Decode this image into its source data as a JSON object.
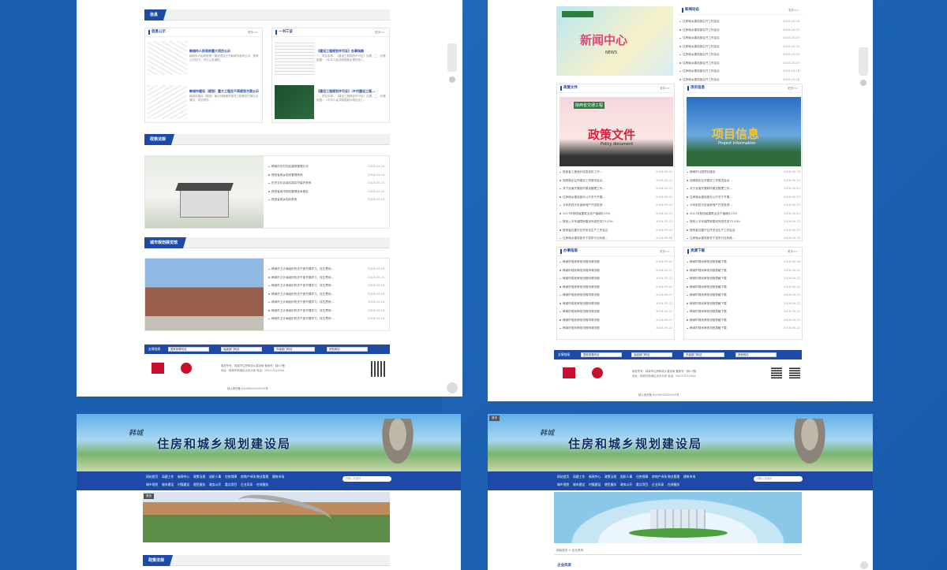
{
  "s1": {
    "info_title": "信息",
    "notice": {
      "title": "信息公示",
      "more": "更多>>",
      "items": [
        {
          "title": "韩城市人民政府重大项目公示",
          "text": "韩城市人民政府第一建设项目已于韩城市各项公示，具体公示如下，详见公告通知。"
        },
        {
          "title": "韩城市建设（规划）重大工程及不同规划方案公示",
          "text": "韩城市建设（规划）局公布韩城市各项工程规划方案公示情况，详见附件。"
        }
      ]
    },
    "one_two_three": {
      "title": "一书三证",
      "more": "更多>>",
      "items": [
        {
          "title": "《建设工程规划许可证》办事指南",
          "text": "一、项目名称：《建设工程规划许可证》办理。二、办理依据：《中华人民共和国城乡规划法》。"
        },
        {
          "title": "《建设工程规划许可证》（乡村建设工程...",
          "text": "一、项目名称：《建设工程规划许可证》办理。二、办理依据：《中华人民共和国城乡规划法》。"
        }
      ]
    },
    "policy": {
      "title": "政策法规",
      "items": [
        {
          "t": "韩城市农村村民建房管理办法",
          "d": "2018-05-14"
        },
        {
          "t": "陕西省城乡规划管理条例",
          "d": "2018-05-14"
        },
        {
          "t": "历史文化名城名镇名村保护条例",
          "d": "2018-05-14"
        },
        {
          "t": "陕西省城市规划管理技术规定",
          "d": "2018-05-10"
        },
        {
          "t": "陕西省城乡规划条例",
          "d": "2018-05-10"
        }
      ]
    },
    "hall": {
      "title": "城市规划展览馆",
      "items": [
        {
          "t": "韩城市卫计局组织机关干部开展学习，传达贯彻...",
          "d": "2018-05-24"
        },
        {
          "t": "韩城市卫计局组织机关干部开展学习，传达贯彻...",
          "d": "2018-05-24"
        },
        {
          "t": "韩城市卫计局组织机关干部开展学习，传达贯彻...",
          "d": "2018-05-24"
        },
        {
          "t": "韩城市卫计局组织机关干部开展学习，传达贯彻...",
          "d": "2018-05-24"
        },
        {
          "t": "韩城市卫计局组织机关干部开展学习，传达贯彻...",
          "d": "2018-05-24"
        },
        {
          "t": "韩城市卫计局组织机关干部开展学习，传达贯彻...",
          "d": "2018-05-24"
        },
        {
          "t": "韩城市卫计局组织机关干部开展学习，传达贯彻...",
          "d": "2018-05-24"
        }
      ]
    },
    "friend_label": "友情链接",
    "selects": [
      "国家部委网站",
      "省级部门网站",
      "市级部门网站",
      "其他网站"
    ],
    "footer": [
      "版权所有：韩城市住房和城乡建设局  备案号：陕ICP备",
      "地址：韩城市新城区太史大街  电话：0913-5212034"
    ],
    "icp": "陕公网安备 61058102000192号"
  },
  "s2": {
    "news": {
      "banner_big": "新闻中心",
      "banner_small": "NEWS",
      "title": "新闻动态",
      "more": "更多>>",
      "items": [
        {
          "t": "住房城乡建设部召开工作会议",
          "d": "2018-05-28"
        },
        {
          "t": "住房城乡建设部召开工作会议",
          "d": "2018-05-25"
        },
        {
          "t": "住房城乡建设部召开工作会议",
          "d": "2018-05-25"
        },
        {
          "t": "住房城乡建设部召开工作会议",
          "d": "2018-05-25"
        },
        {
          "t": "住房城乡建设部召开工作会议",
          "d": "2018-05-25"
        },
        {
          "t": "住房城乡建设部召开工作会议",
          "d": "2018-05-25"
        },
        {
          "t": "住房城乡建设部召开工作会议",
          "d": "2018-05-18"
        },
        {
          "t": "住房城乡建设部召开工作会议",
          "d": "2018-05-18"
        }
      ]
    },
    "policy": {
      "title": "政策文件",
      "more": "更多>>",
      "img_title": "政策文件",
      "img_sub": "Policy document",
      "logo": "陕西省交通工程",
      "items": [
        {
          "t": "陕西省工程造价信息发布工作...",
          "d": "2018-05-23"
        },
        {
          "t": "西咸新区召开建设工作推进会议...",
          "d": "2018-05-23"
        },
        {
          "t": "关于全面开展城市建设管理工作...",
          "d": "2018-05-23"
        },
        {
          "t": "住房城乡建设部办公厅关于开展...",
          "d": "2018-05-23"
        },
        {
          "t": "今年前四月全省房地产开发投资...",
          "d": "2018-05-23"
        },
        {
          "t": "2017年陕西省建筑业总产值增长13%",
          "d": "2018-05-23"
        },
        {
          "t": "陕西上半年保障房建设完成任务75.53%",
          "d": "2018-05-23"
        },
        {
          "t": "陕西省住建厅召开安全生产工作会议",
          "d": "2018-05-23"
        },
        {
          "t": "住房城乡建设部关于发布行业标准...",
          "d": "2018-05-18"
        }
      ]
    },
    "project": {
      "title": "项目信息",
      "more": "更多>>",
      "img_title": "项目信息",
      "img_sub": "Project information",
      "items": [
        {
          "t": "韩城市公园项目建设",
          "d": "2018-05-18"
        },
        {
          "t": "西咸新区召开建设工作推进会议...",
          "d": "2018-05-23"
        },
        {
          "t": "关于全面开展城市建设管理工作...",
          "d": "2018-05-23"
        },
        {
          "t": "住房城乡建设部办公厅关于开展...",
          "d": "2018-05-23"
        },
        {
          "t": "今年前四月全省房地产开发投资...",
          "d": "2018-05-23"
        },
        {
          "t": "2017年陕西省建筑业总产值增长13%",
          "d": "2018-05-23"
        },
        {
          "t": "陕西上半年保障房建设完成任务75.53%",
          "d": "2018-05-23"
        },
        {
          "t": "陕西省住建厅召开安全生产工作会议",
          "d": "2018-05-23"
        },
        {
          "t": "住房城乡建设部关于发布行业标准...",
          "d": "2018-05-18"
        }
      ]
    },
    "guide": {
      "title": "办事指南",
      "more": "更多>>",
      "items": [
        {
          "t": "韩城市规划审批流程申请流程",
          "d": "2018-05-22"
        },
        {
          "t": "韩城市规划审批流程申请流程",
          "d": "2018-05-22"
        },
        {
          "t": "韩城市规划审批流程申请流程",
          "d": "2018-05-22"
        },
        {
          "t": "韩城市规划审批流程申请流程",
          "d": "2018-05-22"
        },
        {
          "t": "韩城市规划审批流程申请流程",
          "d": "2018-05-22"
        },
        {
          "t": "韩城市规划审批流程申请流程",
          "d": "2018-05-22"
        },
        {
          "t": "韩城市规划审批流程申请流程",
          "d": "2018-05-22"
        },
        {
          "t": "韩城市规划审批流程申请流程",
          "d": "2018-05-22"
        },
        {
          "t": "韩城市规划审批流程申请流程",
          "d": "2018-05-22"
        }
      ]
    },
    "download": {
      "title": "资源下载",
      "more": "更多>>",
      "items": [
        {
          "t": "韩城市规划审批流程表格下载",
          "d": "2018-05-16"
        },
        {
          "t": "韩城市规划审批流程表格下载",
          "d": "2018-05-22"
        },
        {
          "t": "韩城市规划审批流程表格下载",
          "d": "2018-05-22"
        },
        {
          "t": "韩城市规划审批流程表格下载",
          "d": "2018-05-22"
        },
        {
          "t": "韩城市规划审批流程表格下载",
          "d": "2018-05-22"
        },
        {
          "t": "韩城市规划审批流程表格下载",
          "d": "2018-05-22"
        },
        {
          "t": "韩城市规划审批流程表格下载",
          "d": "2018-05-22"
        },
        {
          "t": "韩城市规划审批流程表格下载",
          "d": "2018-05-22"
        },
        {
          "t": "韩城市规划审批流程表格下载",
          "d": "2018-05-22"
        }
      ]
    },
    "friend_label": "友情链接",
    "selects": [
      "国家部委网站",
      "省级部门网站",
      "市级部门网站",
      "其他网站"
    ],
    "footer": [
      "版权所有：韩城市住房和城乡建设局  备案号：陕ICP备",
      "地址：韩城市新城区太史大街  电话：0913-5212034"
    ],
    "icp": "陕公网安备 61058102000192号"
  },
  "header": {
    "sig": "韩城",
    "title": "住房和城乡规划建设局",
    "nav_row1": [
      "网站首页",
      "局建工作",
      "新闻中心",
      "政策法规",
      "组织人事",
      "住房保障",
      "房地产市场",
      "物业管理",
      "建筑市场"
    ],
    "nav_row2": [
      "城乡规划",
      "城市建设",
      "村镇建设",
      "便民服务",
      "政务公开",
      "重点项目",
      "企业风采",
      "在线服务"
    ],
    "search_placeholder": "请输入关键词"
  },
  "s3": {
    "tag": "首页",
    "section": "政策法规"
  },
  "s4": {
    "tag": "首页",
    "crumb": "网站首页 > 企业风采",
    "section": "企业风采"
  }
}
